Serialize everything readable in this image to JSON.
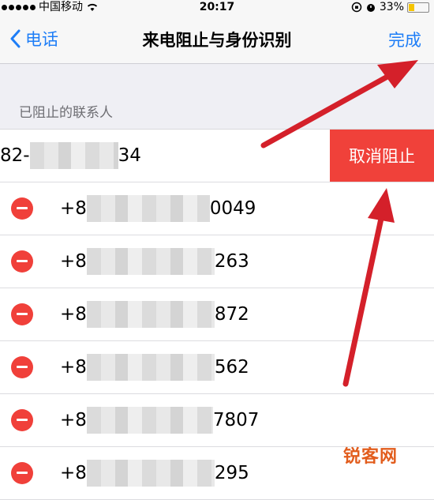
{
  "status_bar": {
    "carrier": "中国移动",
    "time": "20:17",
    "battery": "33%"
  },
  "nav": {
    "back_label": "电话",
    "title": "来电阻止与身份识别",
    "done_label": "完成"
  },
  "section": {
    "header": "已阻止的联系人"
  },
  "contacts": [
    {
      "prefix": "82-",
      "suffix": "34"
    },
    {
      "prefix": "+8",
      "suffix": "0049"
    },
    {
      "prefix": "+8",
      "suffix": "263"
    },
    {
      "prefix": "+8",
      "suffix": "872"
    },
    {
      "prefix": "+8",
      "suffix": "562"
    },
    {
      "prefix": "+8",
      "suffix": "7807"
    },
    {
      "prefix": "+8",
      "suffix": "295"
    }
  ],
  "actions": {
    "unblock_label": "取消阻止"
  },
  "watermark": "锐客网",
  "colors": {
    "accent": "#1e7ef7",
    "destructive": "#f0413a",
    "arrow": "#d4202a"
  }
}
